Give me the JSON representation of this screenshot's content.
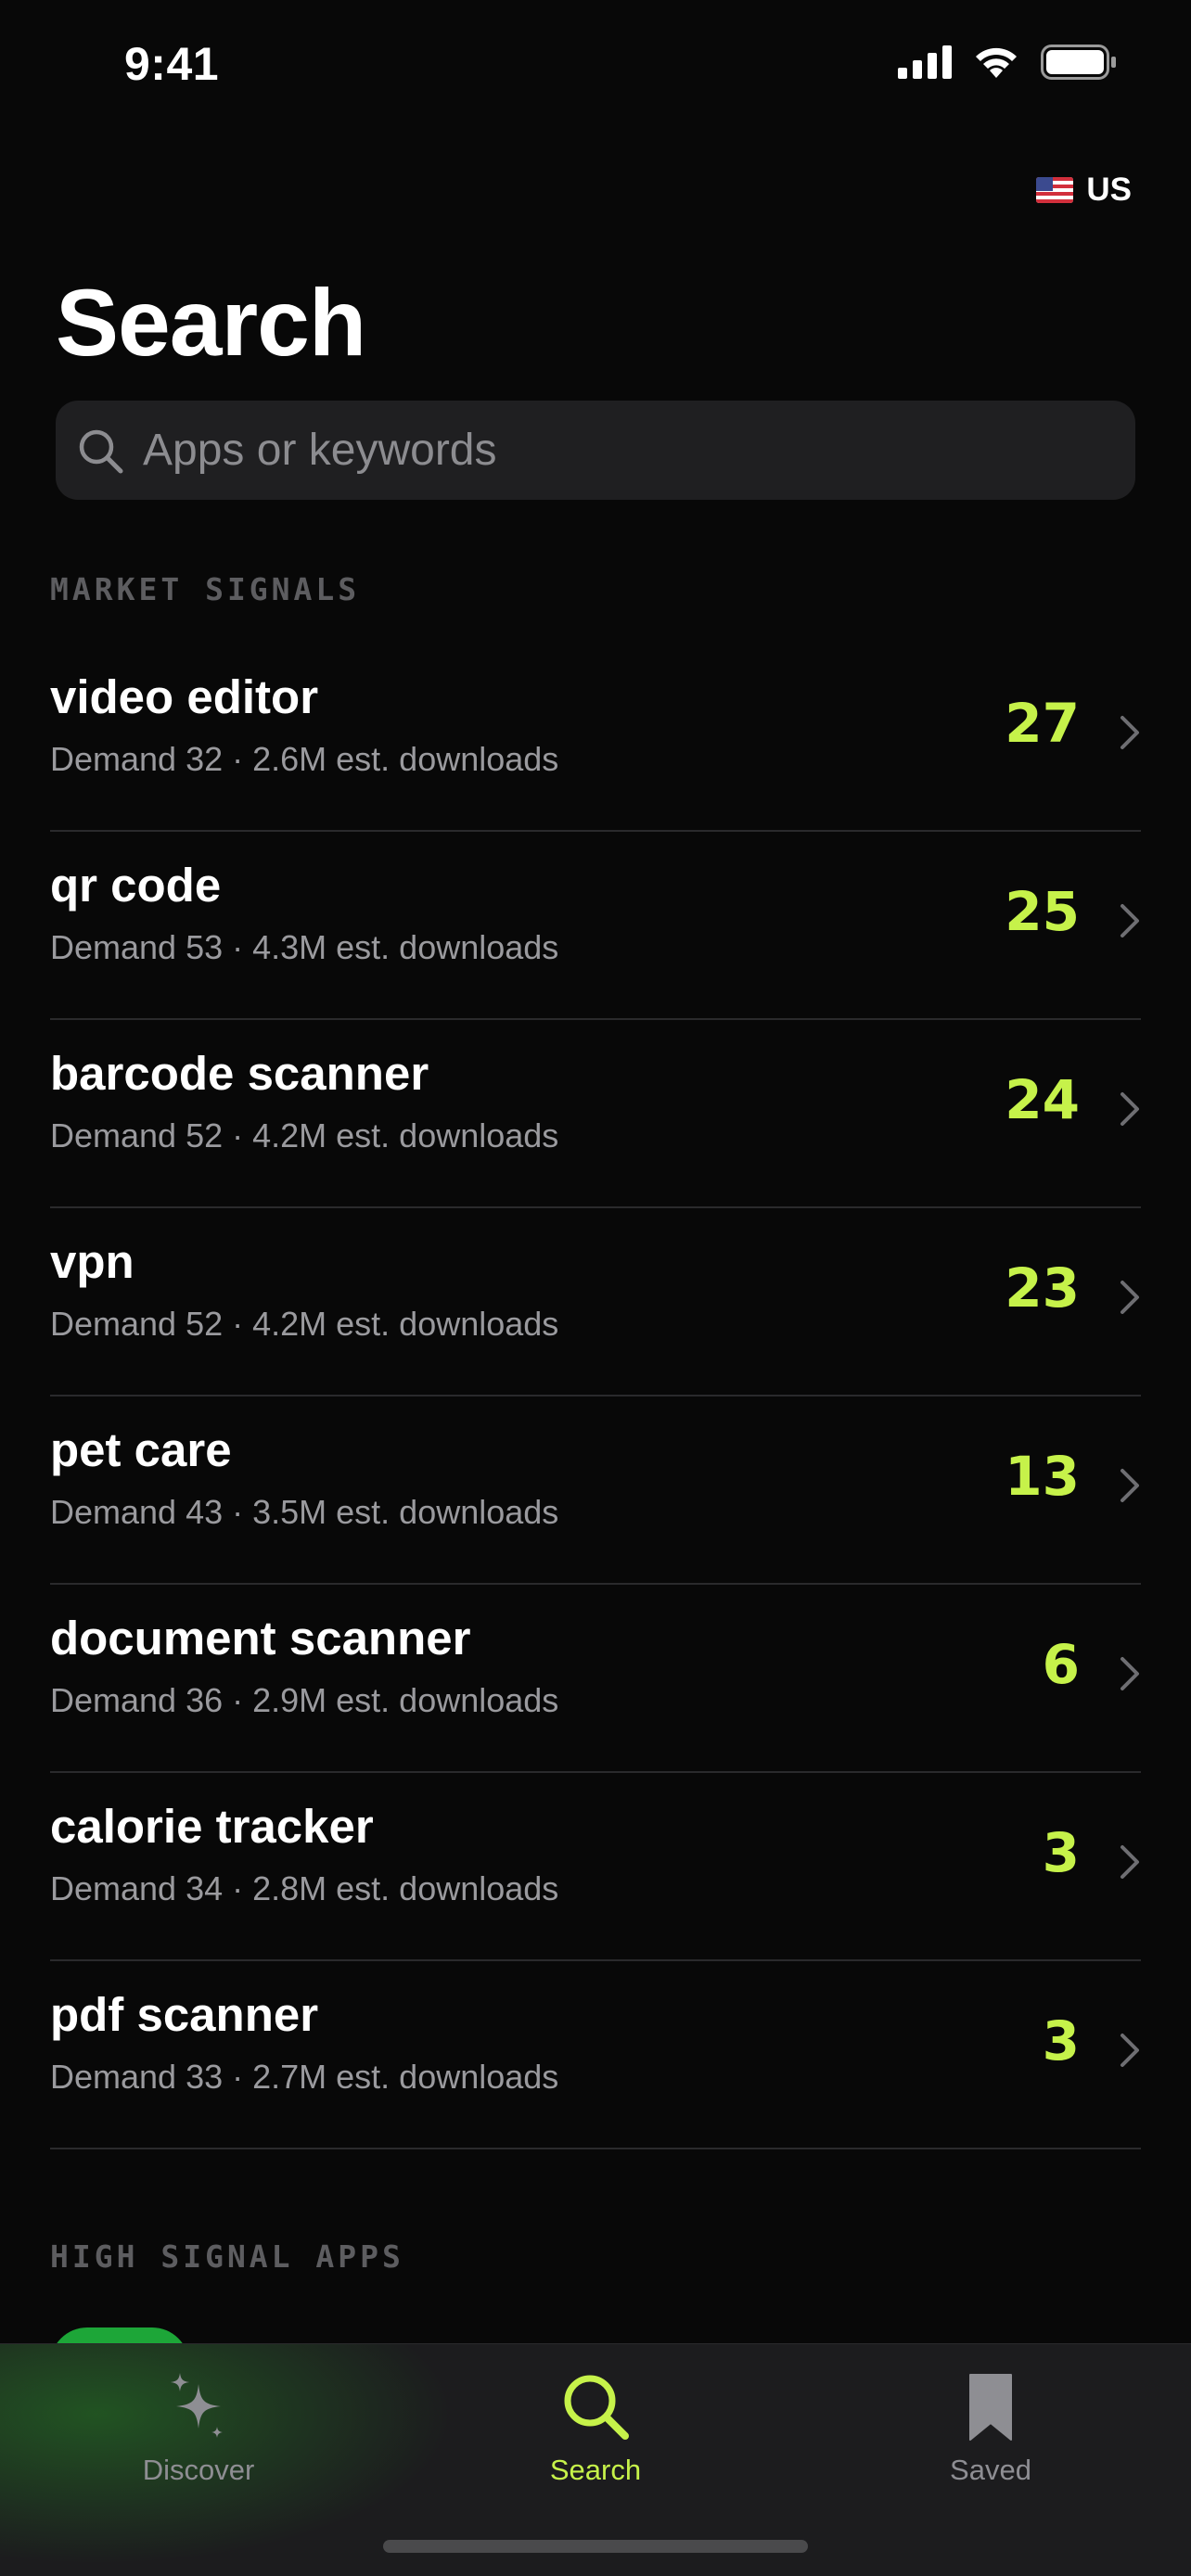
{
  "status_bar": {
    "time": "9:41"
  },
  "region": {
    "flag_icon": "us-flag-icon",
    "label": "US"
  },
  "page_title": "Search",
  "search": {
    "placeholder": "Apps or keywords",
    "value": ""
  },
  "market_signals": {
    "heading": "MARKET SIGNALS",
    "items": [
      {
        "title": "video editor",
        "subtitle": "Demand 32 · 2.6M est. downloads",
        "score": "27"
      },
      {
        "title": "qr code",
        "subtitle": "Demand 53 · 4.3M est. downloads",
        "score": "25"
      },
      {
        "title": "barcode scanner",
        "subtitle": "Demand 52 · 4.2M est. downloads",
        "score": "24"
      },
      {
        "title": "vpn",
        "subtitle": "Demand 52 · 4.2M est. downloads",
        "score": "23"
      },
      {
        "title": "pet care",
        "subtitle": "Demand 43 · 3.5M est. downloads",
        "score": "13"
      },
      {
        "title": "document scanner",
        "subtitle": "Demand 36 · 2.9M est. downloads",
        "score": "6"
      },
      {
        "title": "calorie tracker",
        "subtitle": "Demand 34 · 2.8M est. downloads",
        "score": "3"
      },
      {
        "title": "pdf scanner",
        "subtitle": "Demand 33 · 2.7M est. downloads",
        "score": "3"
      }
    ]
  },
  "high_signal_apps": {
    "heading": "HIGH SIGNAL APPS"
  },
  "tab_bar": {
    "tabs": [
      {
        "label": "Discover",
        "icon": "sparkles-icon",
        "active": false
      },
      {
        "label": "Search",
        "icon": "search-icon",
        "active": true
      },
      {
        "label": "Saved",
        "icon": "bookmark-icon",
        "active": false
      }
    ]
  },
  "colors": {
    "accent": "#c6f24a",
    "background": "#080808",
    "muted_text": "#9a9a9e",
    "inactive_tab": "#8e8e93"
  }
}
